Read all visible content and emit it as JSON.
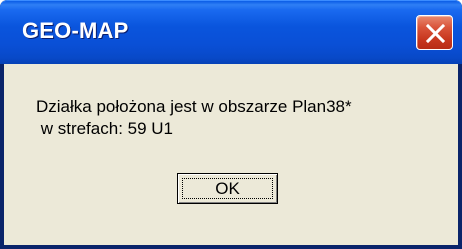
{
  "window": {
    "title": "GEO-MAP",
    "close_icon": "close-icon"
  },
  "dialog": {
    "message_line1": "Działka położona jest w obszarze Plan38*",
    "message_line2": " w strefach: 59 U1",
    "ok_label": "OK"
  },
  "colors": {
    "titlebar": "#0a55dd",
    "close_button": "#d9543a",
    "body": "#ece9d8"
  }
}
